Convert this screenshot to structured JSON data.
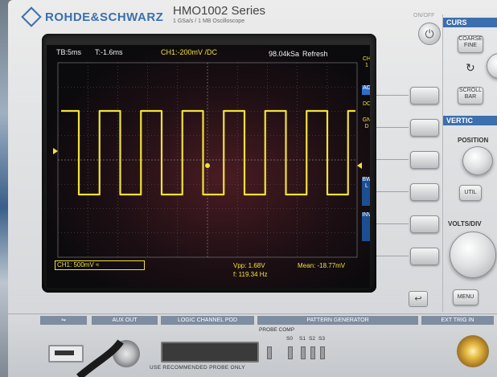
{
  "brand": "ROHDE&SCHWARZ",
  "model": {
    "name": "HMO1002 Series",
    "subtitle": "1 GSa/s / 1 MB Oscilloscope"
  },
  "screen": {
    "status_bar": {
      "timebase": "TB:5ms",
      "trigger_time": "T:-1.6ms",
      "channel_setting": "CH1:-200mV /DC",
      "sample_rate": "98.04kSa",
      "mode": "Refresh"
    },
    "side_menu": {
      "title": "CH1",
      "items": [
        "AC",
        "DC",
        "GND",
        "BWL",
        "INV"
      ],
      "selected": "AC"
    },
    "channel_box": "CH1: 500mV ≈",
    "measurements": {
      "vpp": "Vpp: 1.68V",
      "freq": "f: 119.34 Hz",
      "mean": "Mean: -18.77mV"
    },
    "waveform": {
      "color": "#f1e23a",
      "shape": "square",
      "periods_visible": 7
    }
  },
  "controls": {
    "onoff_label": "ON/OFF",
    "cursor_section": "CURS",
    "vertical_section": "VERTIC",
    "coarse_fine": [
      "COARSE",
      "FINE"
    ],
    "scroll_bar": [
      "SCROLL",
      "BAR"
    ],
    "position_label": "POSITION",
    "util_label": "UTIL",
    "volts_div_label": "VOLTS/DIV",
    "menu_label": "MENU",
    "back_icon": "return-arrow-icon"
  },
  "io_panel": {
    "usb_icon": "usb-icon",
    "aux_out": "AUX OUT",
    "logic_pod": "LOGIC CHANNEL POD",
    "pattern_generator": "PATTERN GENERATOR",
    "probe_comp": "PROBE COMP",
    "pins": [
      "S0",
      "S1",
      "S2",
      "S3"
    ],
    "ext_trig": "EXT TRIG IN",
    "warning": "USE RECOMMENDED PROBE ONLY"
  }
}
